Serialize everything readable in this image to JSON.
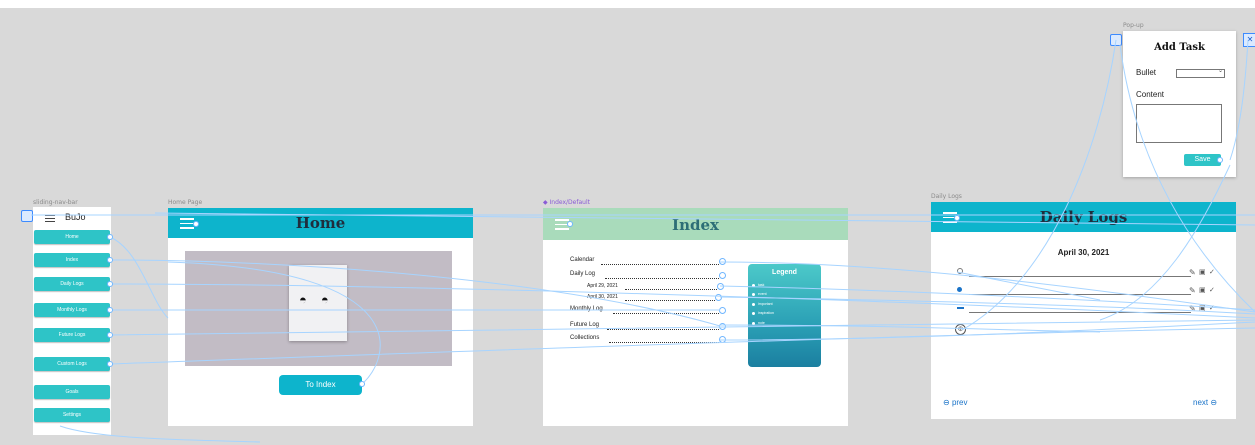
{
  "nav_frame": {
    "label": "sliding-nav-bar",
    "brand": "BuJo",
    "items": [
      "Home",
      "Index",
      "Daily Logs",
      "Monthly Logs",
      "Future Logs",
      "Custom Logs",
      "Goals",
      "Settings"
    ]
  },
  "home_frame": {
    "label": "Home Page",
    "title": "Home",
    "to_index_button": "To Index"
  },
  "index_frame": {
    "label": "◆ Index/Default",
    "title": "Index",
    "rows": [
      "Calendar",
      "Daily Log",
      "April 29, 2021",
      "April 30, 2021",
      "Monthly Log",
      "Future Log",
      "Collections"
    ],
    "legend_title": "Legend",
    "legend_items": [
      "task",
      "event",
      "important",
      "inspiration",
      "note"
    ]
  },
  "daily_frame": {
    "label": "Daily Logs",
    "title": "Daily Logs",
    "date": "April 30, 2021",
    "prev": "prev",
    "next": "next"
  },
  "popup": {
    "label": "Pop-up",
    "title": "Add Task",
    "bullet_label": "Bullet",
    "content_label": "Content",
    "save": "Save"
  },
  "colors": {
    "teal": "#0db4cc",
    "pill": "#2ec4c7",
    "index_header": "#a9dbbb",
    "link_line": "#a7d4ff",
    "canvas": "#d9d9d9"
  }
}
